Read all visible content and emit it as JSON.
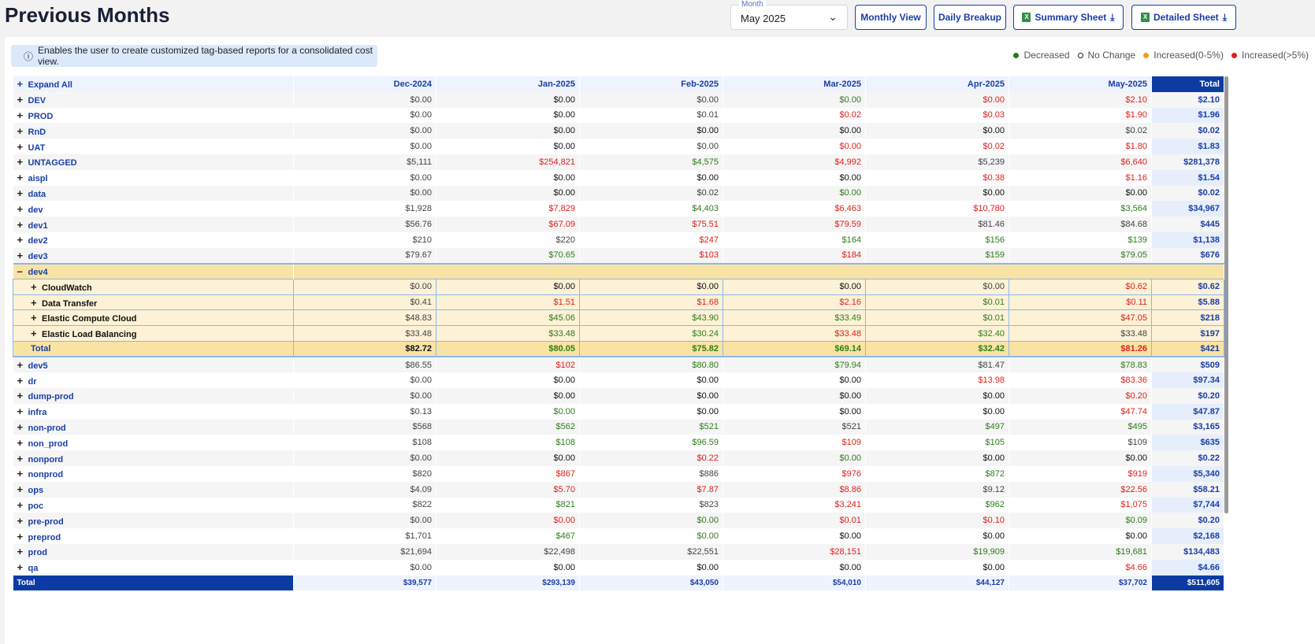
{
  "header": {
    "title": "Previous Months",
    "month_label": "Month",
    "month_value": "May 2025",
    "buttons": [
      "Monthly View",
      "Daily Breakup",
      "Summary Sheet",
      "Detailed Sheet"
    ]
  },
  "info": "Enables the user to create customized tag-based reports for a consolidated cost view.",
  "legend": [
    {
      "label": "Decreased",
      "color": "#1e7a12"
    },
    {
      "label": "No Change",
      "color": "#ffffff"
    },
    {
      "label": "Increased(0-5%)",
      "color": "#f39c12"
    },
    {
      "label": "Increased(>5%)",
      "color": "#e0201b"
    }
  ],
  "table": {
    "expand_all": "Expand All",
    "columns": [
      "Dec-2024",
      "Jan-2025",
      "Feb-2025",
      "Mar-2025",
      "Apr-2025",
      "May-2025",
      "Total"
    ],
    "rows": [
      {
        "name": "DEV",
        "values": [
          "$0.00",
          "$0.00",
          "$0.00",
          "$0.00",
          "$0.00",
          "$2.10"
        ],
        "status": [
          "n",
          "k",
          "n",
          "g",
          "r",
          "r"
        ],
        "total": "$2.10"
      },
      {
        "name": "PROD",
        "values": [
          "$0.00",
          "$0.00",
          "$0.01",
          "$0.02",
          "$0.03",
          "$1.90"
        ],
        "status": [
          "n",
          "k",
          "n",
          "r",
          "r",
          "r"
        ],
        "total": "$1.96"
      },
      {
        "name": "RnD",
        "values": [
          "$0.00",
          "$0.00",
          "$0.00",
          "$0.00",
          "$0.00",
          "$0.02"
        ],
        "status": [
          "n",
          "k",
          "k",
          "k",
          "k",
          "n"
        ],
        "total": "$0.02"
      },
      {
        "name": "UAT",
        "values": [
          "$0.00",
          "$0.00",
          "$0.00",
          "$0.00",
          "$0.02",
          "$1.80"
        ],
        "status": [
          "n",
          "k",
          "n",
          "r",
          "r",
          "r"
        ],
        "total": "$1.83"
      },
      {
        "name": "UNTAGGED",
        "values": [
          "$5,111",
          "$254,821",
          "$4,575",
          "$4,992",
          "$5,239",
          "$6,640"
        ],
        "status": [
          "n",
          "r",
          "g",
          "r",
          "n",
          "r"
        ],
        "total": "$281,378"
      },
      {
        "name": "aispl",
        "values": [
          "$0.00",
          "$0.00",
          "$0.00",
          "$0.00",
          "$0.38",
          "$1.16"
        ],
        "status": [
          "n",
          "k",
          "k",
          "k",
          "r",
          "r"
        ],
        "total": "$1.54"
      },
      {
        "name": "data",
        "values": [
          "$0.00",
          "$0.00",
          "$0.02",
          "$0.00",
          "$0.00",
          "$0.00"
        ],
        "status": [
          "n",
          "k",
          "n",
          "g",
          "k",
          "k"
        ],
        "total": "$0.02"
      },
      {
        "name": "dev",
        "values": [
          "$1,928",
          "$7,829",
          "$4,403",
          "$6,463",
          "$10,780",
          "$3,564"
        ],
        "status": [
          "n",
          "r",
          "g",
          "r",
          "r",
          "g"
        ],
        "total": "$34,967"
      },
      {
        "name": "dev1",
        "values": [
          "$56.76",
          "$67.09",
          "$75.51",
          "$79.59",
          "$81.46",
          "$84.68"
        ],
        "status": [
          "n",
          "r",
          "r",
          "r",
          "n",
          "n"
        ],
        "total": "$445"
      },
      {
        "name": "dev2",
        "values": [
          "$210",
          "$220",
          "$247",
          "$164",
          "$156",
          "$139"
        ],
        "status": [
          "n",
          "n",
          "r",
          "g",
          "g",
          "g"
        ],
        "total": "$1,138"
      },
      {
        "name": "dev3",
        "values": [
          "$79.67",
          "$70.65",
          "$103",
          "$184",
          "$159",
          "$79.05"
        ],
        "status": [
          "n",
          "g",
          "r",
          "r",
          "g",
          "g"
        ],
        "total": "$676"
      },
      {
        "name": "dev4",
        "expanded": true,
        "children": [
          {
            "name": "CloudWatch",
            "values": [
              "$0.00",
              "$0.00",
              "$0.00",
              "$0.00",
              "$0.00",
              "$0.62"
            ],
            "status": [
              "n",
              "k",
              "k",
              "k",
              "n",
              "r"
            ],
            "total": "$0.62"
          },
          {
            "name": "Data Transfer",
            "values": [
              "$0.41",
              "$1.51",
              "$1.68",
              "$2.16",
              "$0.01",
              "$0.11"
            ],
            "status": [
              "n",
              "r",
              "r",
              "r",
              "g",
              "r"
            ],
            "total": "$5.88"
          },
          {
            "name": "Elastic Compute Cloud",
            "values": [
              "$48.83",
              "$45.06",
              "$43.90",
              "$33.49",
              "$0.01",
              "$47.05"
            ],
            "status": [
              "n",
              "g",
              "g",
              "g",
              "g",
              "r"
            ],
            "total": "$218"
          },
          {
            "name": "Elastic Load Balancing",
            "values": [
              "$33.48",
              "$33.48",
              "$30.24",
              "$33.48",
              "$32.40",
              "$33.48"
            ],
            "status": [
              "n",
              "g",
              "g",
              "r",
              "g",
              "n"
            ],
            "total": "$197"
          }
        ],
        "subtotal": {
          "name": "Total",
          "values": [
            "$82.72",
            "$80.05",
            "$75.82",
            "$69.14",
            "$32.42",
            "$81.26"
          ],
          "status": [
            "k",
            "g",
            "g",
            "g",
            "g",
            "r"
          ],
          "total": "$421"
        }
      },
      {
        "name": "dev5",
        "values": [
          "$86.55",
          "$102",
          "$80.80",
          "$79.94",
          "$81.47",
          "$78.83"
        ],
        "status": [
          "n",
          "r",
          "g",
          "g",
          "n",
          "g"
        ],
        "total": "$509"
      },
      {
        "name": "dr",
        "values": [
          "$0.00",
          "$0.00",
          "$0.00",
          "$0.00",
          "$13.98",
          "$83.36"
        ],
        "status": [
          "n",
          "k",
          "k",
          "k",
          "r",
          "r"
        ],
        "total": "$97.34"
      },
      {
        "name": "dump-prod",
        "values": [
          "$0.00",
          "$0.00",
          "$0.00",
          "$0.00",
          "$0.00",
          "$0.20"
        ],
        "status": [
          "n",
          "k",
          "k",
          "k",
          "k",
          "r"
        ],
        "total": "$0.20"
      },
      {
        "name": "infra",
        "values": [
          "$0.13",
          "$0.00",
          "$0.00",
          "$0.00",
          "$0.00",
          "$47.74"
        ],
        "status": [
          "n",
          "g",
          "k",
          "k",
          "k",
          "r"
        ],
        "total": "$47.87"
      },
      {
        "name": "non-prod",
        "values": [
          "$568",
          "$562",
          "$521",
          "$521",
          "$497",
          "$495"
        ],
        "status": [
          "n",
          "g",
          "g",
          "n",
          "g",
          "g"
        ],
        "total": "$3,165"
      },
      {
        "name": "non_prod",
        "values": [
          "$108",
          "$108",
          "$96.59",
          "$109",
          "$105",
          "$109"
        ],
        "status": [
          "n",
          "g",
          "g",
          "r",
          "g",
          "n"
        ],
        "total": "$635"
      },
      {
        "name": "nonpord",
        "values": [
          "$0.00",
          "$0.00",
          "$0.22",
          "$0.00",
          "$0.00",
          "$0.00"
        ],
        "status": [
          "n",
          "k",
          "r",
          "g",
          "k",
          "k"
        ],
        "total": "$0.22"
      },
      {
        "name": "nonprod",
        "values": [
          "$820",
          "$867",
          "$886",
          "$976",
          "$872",
          "$919"
        ],
        "status": [
          "n",
          "r",
          "n",
          "r",
          "g",
          "r"
        ],
        "total": "$5,340"
      },
      {
        "name": "ops",
        "values": [
          "$4.09",
          "$5.70",
          "$7.87",
          "$8.86",
          "$9.12",
          "$22.56"
        ],
        "status": [
          "n",
          "r",
          "r",
          "r",
          "n",
          "r"
        ],
        "total": "$58.21"
      },
      {
        "name": "poc",
        "values": [
          "$822",
          "$821",
          "$823",
          "$3,241",
          "$962",
          "$1,075"
        ],
        "status": [
          "n",
          "g",
          "n",
          "r",
          "g",
          "r"
        ],
        "total": "$7,744"
      },
      {
        "name": "pre-prod",
        "values": [
          "$0.00",
          "$0.00",
          "$0.00",
          "$0.01",
          "$0.10",
          "$0.09"
        ],
        "status": [
          "n",
          "r",
          "g",
          "r",
          "r",
          "g"
        ],
        "total": "$0.20"
      },
      {
        "name": "preprod",
        "values": [
          "$1,701",
          "$467",
          "$0.00",
          "$0.00",
          "$0.00",
          "$0.00"
        ],
        "status": [
          "n",
          "g",
          "g",
          "k",
          "k",
          "k"
        ],
        "total": "$2,168"
      },
      {
        "name": "prod",
        "values": [
          "$21,694",
          "$22,498",
          "$22,551",
          "$28,151",
          "$19,909",
          "$19,681"
        ],
        "status": [
          "n",
          "n",
          "n",
          "r",
          "g",
          "g"
        ],
        "total": "$134,483"
      },
      {
        "name": "qa",
        "values": [
          "$0.00",
          "$0.00",
          "$0.00",
          "$0.00",
          "$0.00",
          "$4.66"
        ],
        "status": [
          "n",
          "k",
          "k",
          "k",
          "k",
          "r"
        ],
        "total": "$4.66"
      }
    ],
    "footer": {
      "name": "Total",
      "values": [
        "$39,577",
        "$293,139",
        "$43,050",
        "$54,010",
        "$44,127",
        "$37,702"
      ],
      "total": "$511,605"
    }
  }
}
